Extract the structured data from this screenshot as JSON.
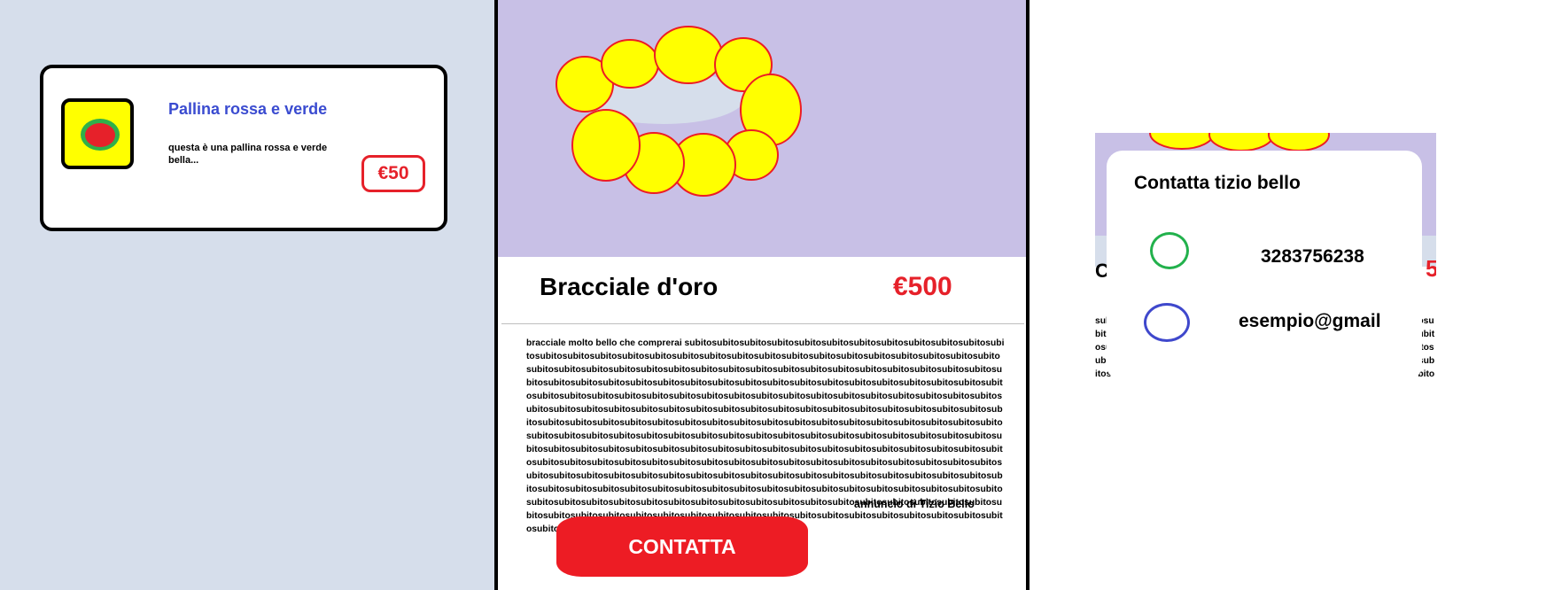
{
  "product_card": {
    "title": "Pallina rossa e verde",
    "description": "questa è una pallina rossa e verde bella...",
    "price": "€50"
  },
  "detail": {
    "title": "Bracciale d'oro",
    "price": "€500",
    "description": "bracciale molto bello che comprerai subitosubitosubitosubitosubitosubitosubitosubitosubitosubitosubitosubitosubitosubitosubitosubitosubitosubitosubitosubitosubitosubitosubitosubitosubitosubitosubitosubitosubitosubitosubitosubitosubitosubitosubitosubitosubitosubitosubitosubitosubitosubitosubitosubitosubitosubitosubitosubitosubitosubitosubitosubitosubitosubitosubitosubitosubitosubitosubitosubitosubitosubitosubitosubitosubitosubitosubitosubitosubitosubitosubitosubitosubitosubitosubitosubitosubitosubitosubitosubitosubitosubitosubitosubitosubitosubitosubitosubitosubitosubitosubitosubitosubitosubitosubitosubitosubitosubitosubitosubitosubitosubitosubitosubitosubitosubitosubitosubitosubitosubitosubitosubitosubitosubitosubitosubitosubitosubitosubitosubitosubitosubitosubitosubitosubitosubitosubitosubitosubitosubitosubitosubitosubitosubitosubitosubitosubitosubitosubitosubitosubitosubitosubitosubitosubitosubitosubitosubitosubitosubitosubitosubitosubitosubitosubitosubitosubitosubitosubitosubitosubitosubitosubitosubitosubitosubitosubitosubitosubitosubitosubitosubitosubitosubitosubitosubitosubitosubitosubitosubitosubitosubitosubitosubitosubitosubitosubitosubitosubitosubitosubitosubitosubitosubitosubitosubitosubitosubitosubitosubitosubitosubitosubitosubitosubitosubitosubitosubitosubitosubitosubitosubitosubitosubitosubitosubitosubitosubitosubitosubitosubitosubitosubitosubitosubitosubitosubitosubitosubitosubitosubitosubitosubitosubitosubitosubitosubitosubitosubitosubito",
    "author": "annuncio di Tizio Bello",
    "contact_label": "CONTATTA"
  },
  "contact_modal": {
    "title": "Contatta tizio bello",
    "phone": "3283756238",
    "email": "esempio@gmail",
    "background_title_partial": "C",
    "background_price_partial": "5",
    "background_text": "subitosubitosubitosubitosubitosubitosubitosubitosubitosubitosubitosubitosubitosubitosubitosubitosubitosubitosubitosubitosubitosubitosubitosubitosubitosubitosubitosubitosubitosubitosubitosubitosubitosubitosubitosubitosubitosubitosubitosubitosubitosubitosubitosubitosubitosubitosubitosubitosubitosubitosubitosubitosubitosubitosubitosubitosubitosubitosubitosubitosubitosubito"
  },
  "colors": {
    "panel_background": "#d6deeb",
    "image_background": "#c8c0e6",
    "accent_red": "#e6212a",
    "title_blue": "#3a4bd0",
    "gold": "#ffff00"
  }
}
